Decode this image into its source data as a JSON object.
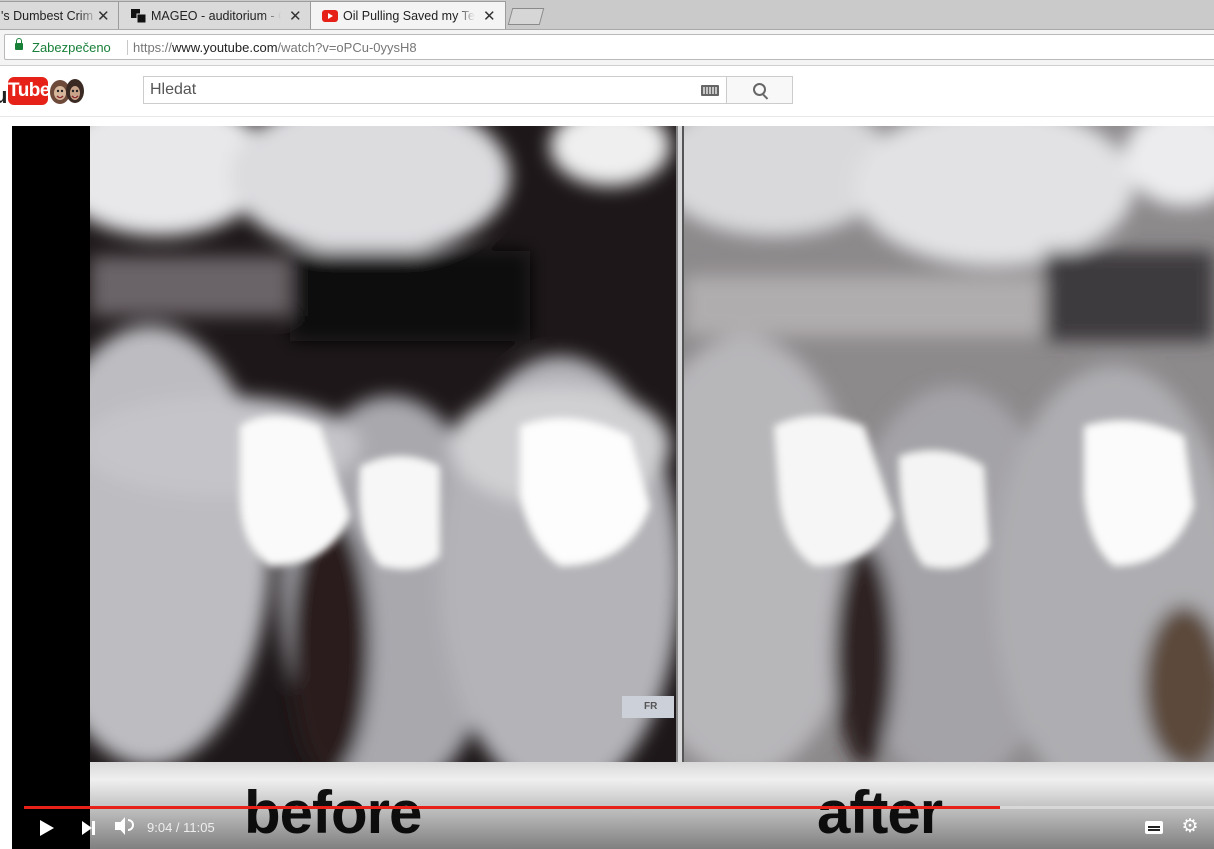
{
  "browser": {
    "tabs": [
      {
        "title": "'s Dumbest Crim",
        "active": false,
        "close": "✕"
      },
      {
        "title": "MAGEO - auditorium - C",
        "active": false,
        "close": "✕"
      },
      {
        "title": "Oil Pulling Saved my Tee",
        "active": true,
        "close": "✕"
      }
    ],
    "secure_label": "Zabezpečeno",
    "url_scheme": "https://",
    "url_host": "www.youtube.com",
    "url_path": "/watch?v=oPCu-0yysH8"
  },
  "youtube": {
    "logo_tube": "Tube",
    "logo_you": "u",
    "search_placeholder": "Hledat"
  },
  "video": {
    "caption_before": "before",
    "caption_after": "after",
    "corner_label": "FR",
    "time_display": "9:04 / 11:05",
    "progress_fraction": 0.82,
    "accent_color": "#e62117"
  },
  "icons": {
    "play": "play-icon",
    "next": "next-icon",
    "volume": "volume-icon",
    "subtitles": "subtitles-icon",
    "settings": "gear-icon",
    "search": "search-icon",
    "keyboard": "keyboard-icon",
    "lock": "lock-icon"
  }
}
